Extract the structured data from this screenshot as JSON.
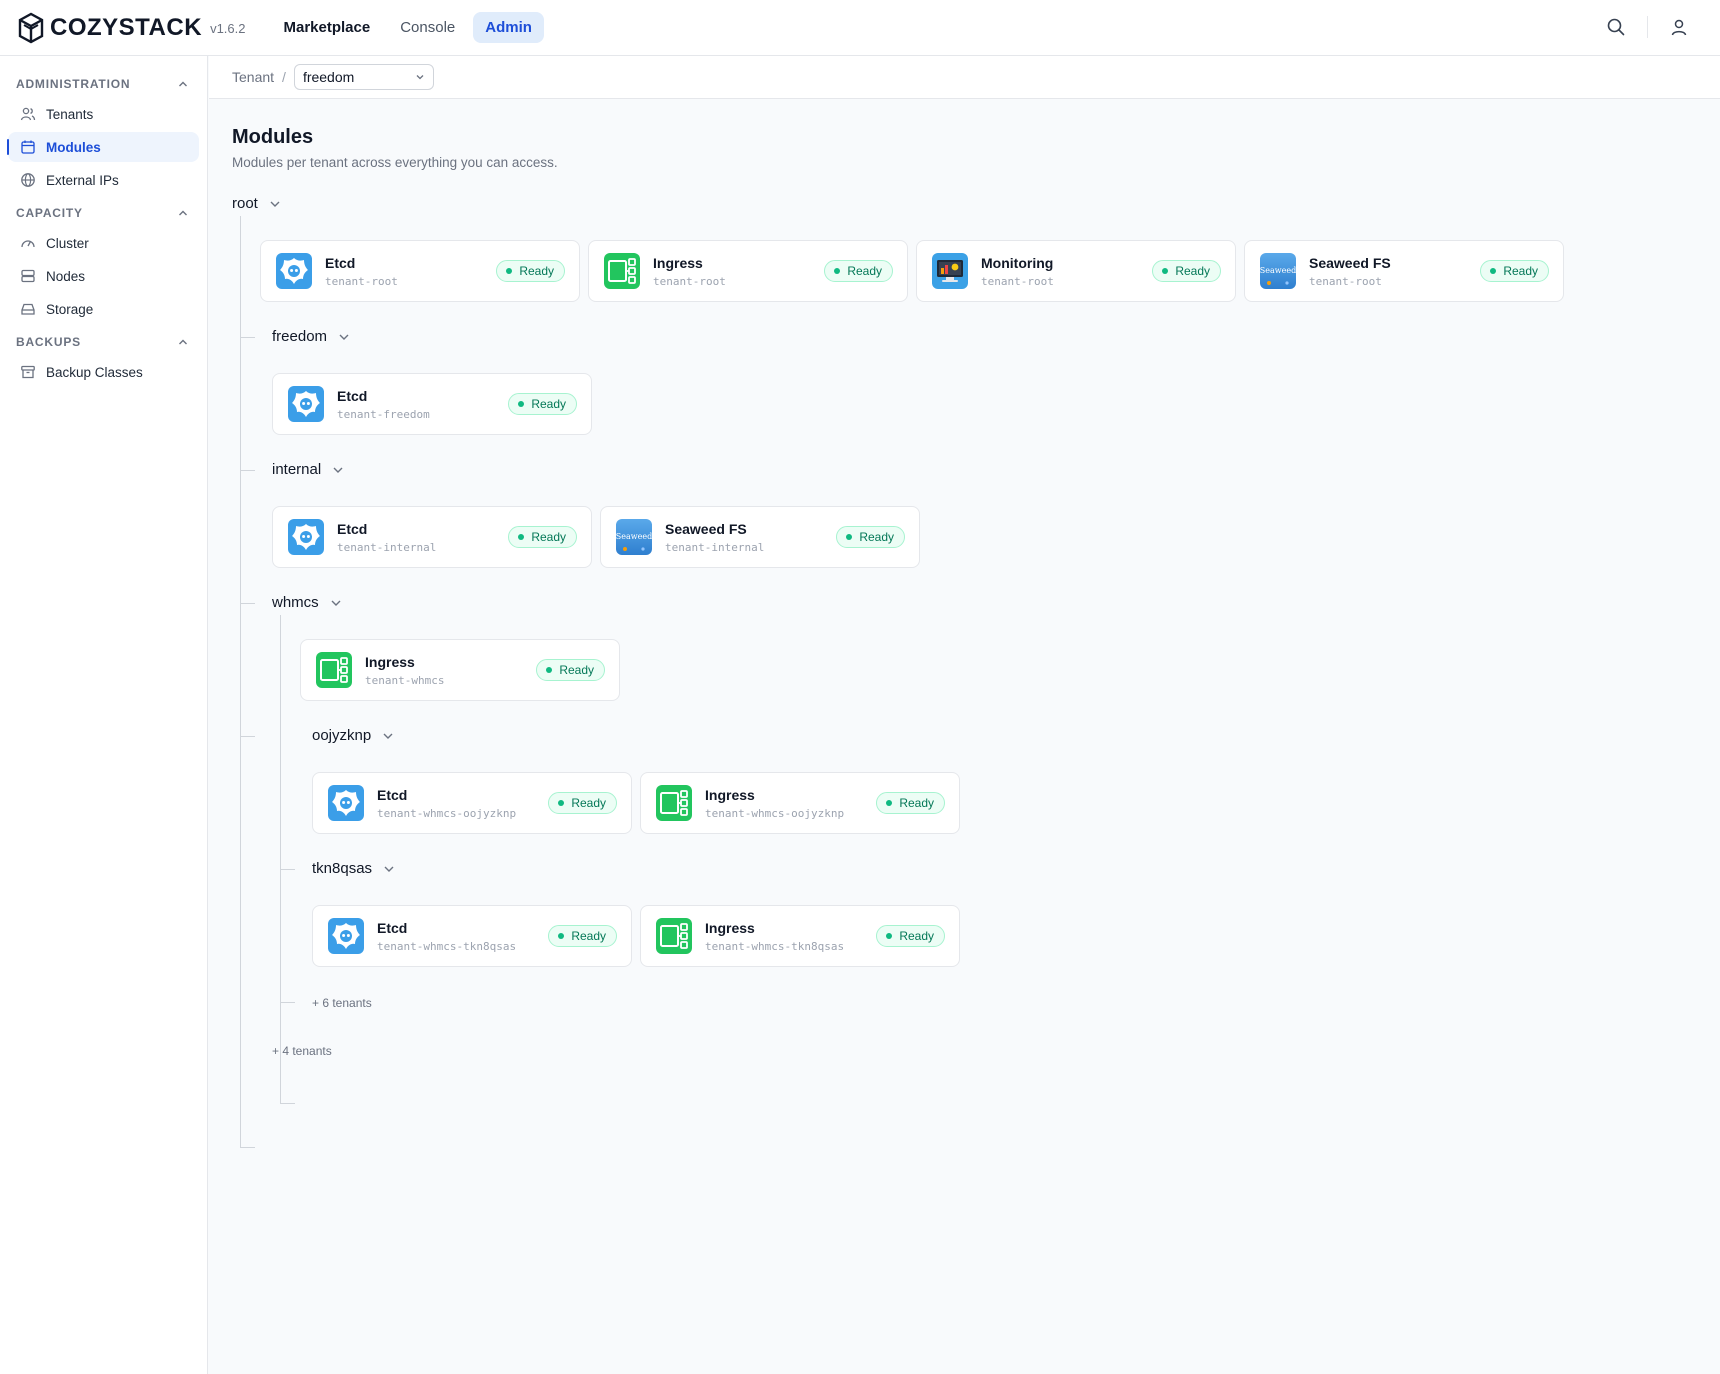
{
  "app": {
    "logo_text": "COZYSTACK",
    "version": "v1.6.2",
    "nav": [
      {
        "label": "Marketplace"
      },
      {
        "label": "Console"
      },
      {
        "label": "Admin"
      }
    ]
  },
  "sidebar": {
    "sections": [
      {
        "label": "ADMINISTRATION",
        "items": [
          {
            "label": "Tenants",
            "icon": "users-icon"
          },
          {
            "label": "Modules",
            "icon": "calendar-icon",
            "active": true
          },
          {
            "label": "External IPs",
            "icon": "globe-icon"
          }
        ]
      },
      {
        "label": "CAPACITY",
        "items": [
          {
            "label": "Cluster",
            "icon": "gauge-icon"
          },
          {
            "label": "Nodes",
            "icon": "server-icon"
          },
          {
            "label": "Storage",
            "icon": "hard-drive-icon"
          }
        ]
      },
      {
        "label": "BACKUPS",
        "items": [
          {
            "label": "Backup Classes",
            "icon": "archive-icon"
          }
        ]
      }
    ]
  },
  "breadcrumb": {
    "root": "Tenant",
    "separator": "/",
    "selected_tenant": "freedom"
  },
  "page": {
    "title": "Modules",
    "subtitle": "Modules per tenant across everything you can access."
  },
  "status_ready": "Ready",
  "tree": {
    "root": {
      "name": "root",
      "modules": [
        {
          "name": "Etcd",
          "ns": "tenant-root",
          "icon": "etcd-icon"
        },
        {
          "name": "Ingress",
          "ns": "tenant-root",
          "icon": "ingress-icon"
        },
        {
          "name": "Monitoring",
          "ns": "tenant-root",
          "icon": "monitoring-icon"
        },
        {
          "name": "Seaweed FS",
          "ns": "tenant-root",
          "icon": "seaweedfs-icon"
        }
      ],
      "more": "+ 4 tenants"
    },
    "freedom": {
      "name": "freedom",
      "modules": [
        {
          "name": "Etcd",
          "ns": "tenant-freedom",
          "icon": "etcd-icon"
        }
      ]
    },
    "internal": {
      "name": "internal",
      "modules": [
        {
          "name": "Etcd",
          "ns": "tenant-internal",
          "icon": "etcd-icon"
        },
        {
          "name": "Seaweed FS",
          "ns": "tenant-internal",
          "icon": "seaweedfs-icon"
        }
      ]
    },
    "whmcs": {
      "name": "whmcs",
      "modules": [
        {
          "name": "Ingress",
          "ns": "tenant-whmcs",
          "icon": "ingress-icon"
        }
      ],
      "more": "+ 6 tenants"
    },
    "oojyzknp": {
      "name": "oojyzknp",
      "modules": [
        {
          "name": "Etcd",
          "ns": "tenant-whmcs-oojyzknp",
          "icon": "etcd-icon"
        },
        {
          "name": "Ingress",
          "ns": "tenant-whmcs-oojyzknp",
          "icon": "ingress-icon"
        }
      ]
    },
    "tkn8qsas": {
      "name": "tkn8qsas",
      "modules": [
        {
          "name": "Etcd",
          "ns": "tenant-whmcs-tkn8qsas",
          "icon": "etcd-icon"
        },
        {
          "name": "Ingress",
          "ns": "tenant-whmcs-tkn8qsas",
          "icon": "ingress-icon"
        }
      ]
    }
  }
}
